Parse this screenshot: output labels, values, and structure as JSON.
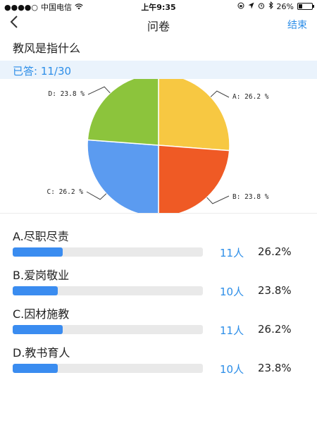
{
  "status_bar": {
    "signal": "●●●●○",
    "carrier": "中国电信",
    "time": "上午9:35",
    "battery": "26%",
    "battery_level": 0.26
  },
  "nav": {
    "back_icon": "chevron-left-icon",
    "title": "问卷",
    "end_label": "结束"
  },
  "question": "教风是指什么",
  "answered": "已答: 11/30",
  "chart_data": {
    "type": "pie",
    "slices": [
      {
        "label": "A: 26.2 %",
        "value": 26.2,
        "color": "#f7c842"
      },
      {
        "label": "B: 23.8 %",
        "value": 23.8,
        "color": "#ef5a25"
      },
      {
        "label": "C: 26.2 %",
        "value": 26.2,
        "color": "#5b9bf0"
      },
      {
        "label": "D: 23.8 %",
        "value": 23.8,
        "color": "#8cc43c"
      }
    ],
    "legend": "none"
  },
  "options": [
    {
      "label": "A.尽职尽责",
      "count": "11人",
      "percent": "26.2%",
      "fraction": 0.262
    },
    {
      "label": "B.爱岗敬业",
      "count": "10人",
      "percent": "23.8%",
      "fraction": 0.238
    },
    {
      "label": "C.因材施教",
      "count": "11人",
      "percent": "26.2%",
      "fraction": 0.262
    },
    {
      "label": "D.教书育人",
      "count": "10人",
      "percent": "23.8%",
      "fraction": 0.238
    }
  ],
  "colors": {
    "accent": "#2d8ee8",
    "bar_fill": "#3a8cf0",
    "bar_track": "#e9e9e9",
    "answered_bg": "#eaf3fc"
  }
}
